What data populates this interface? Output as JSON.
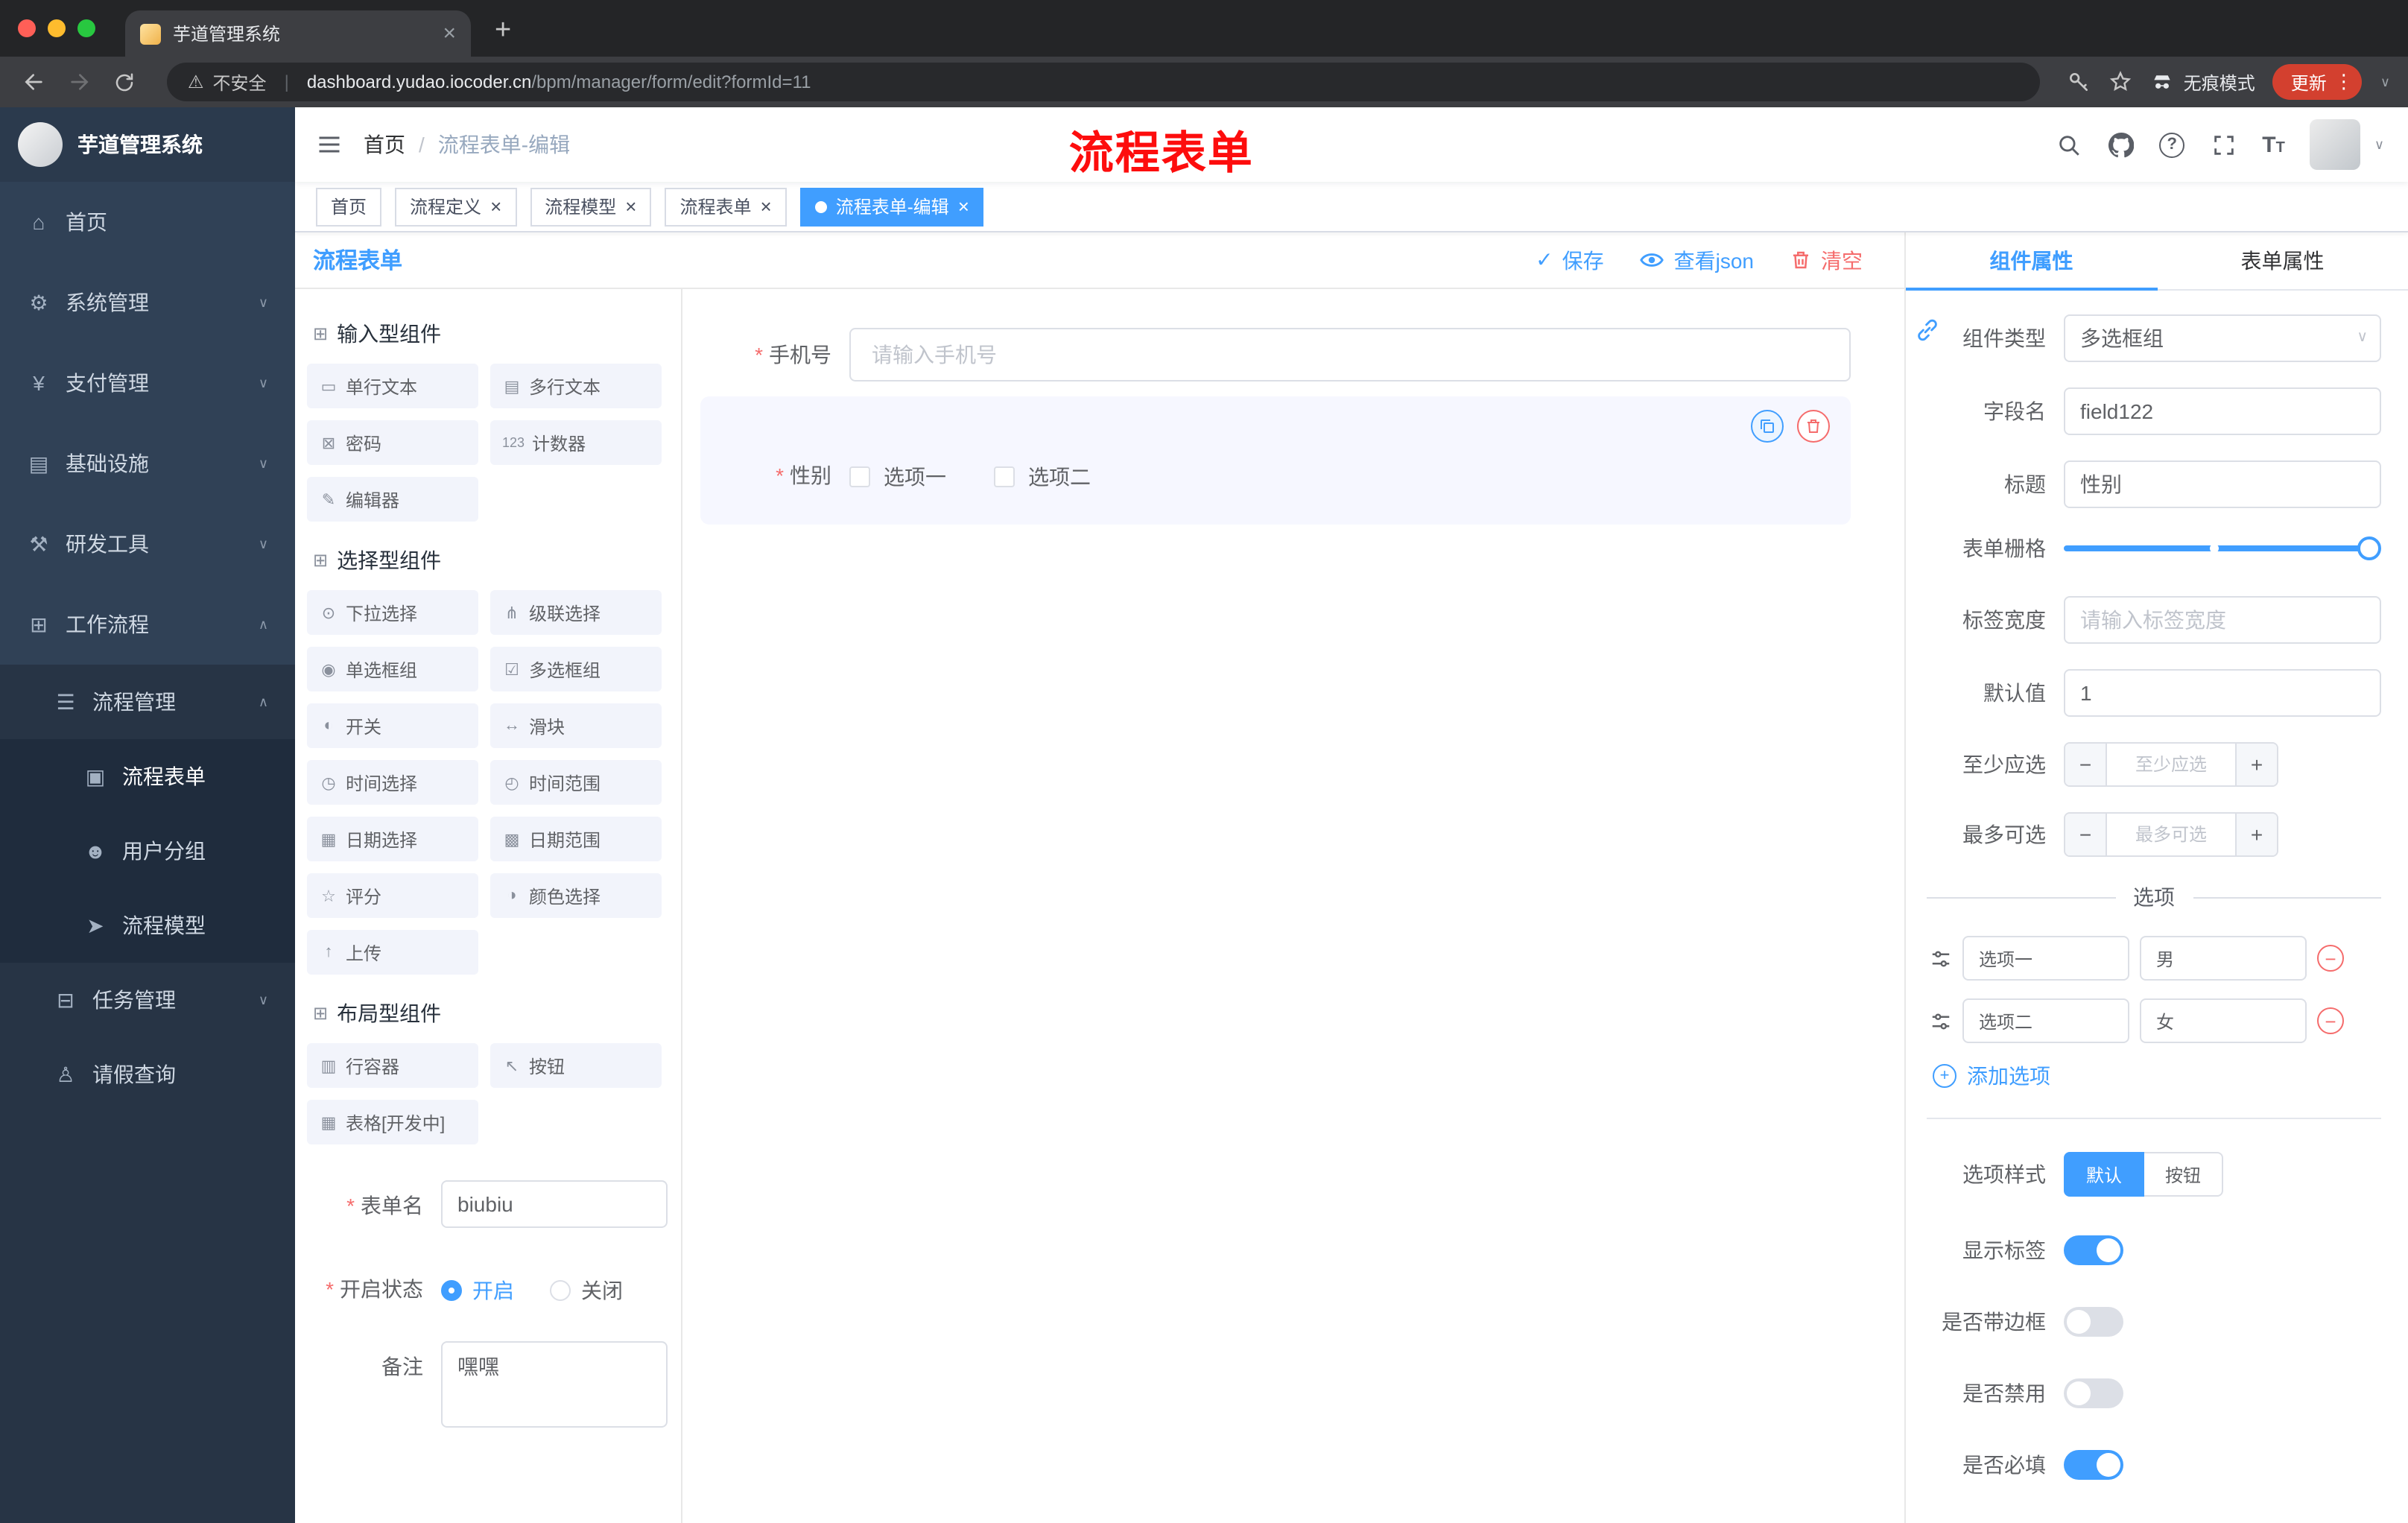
{
  "icons": {
    "home": "⌂",
    "system": "⚙",
    "payment": "¥",
    "infra": "▤",
    "devtools": "⚒",
    "workflow": "⊞",
    "process": "☰",
    "form": "▣",
    "users": "☻",
    "model": "➤",
    "task": "⊟",
    "leave": "♙",
    "group": "⊞"
  },
  "browser": {
    "tab": {
      "title": "芋道管理系统"
    },
    "address": {
      "security_label": "不安全",
      "domain": "dashboard.yudao.iocoder.cn",
      "path": "/bpm/manager/form/edit?formId=11"
    },
    "incognito_label": "无痕模式",
    "update_label": "更新"
  },
  "sidebar": {
    "logo_title": "芋道管理系统",
    "menu": [
      {
        "label": "首页"
      },
      {
        "label": "系统管理"
      },
      {
        "label": "支付管理"
      },
      {
        "label": "基础设施"
      },
      {
        "label": "研发工具"
      },
      {
        "label": "工作流程"
      },
      {
        "label": "流程管理"
      },
      {
        "label": "流程表单"
      },
      {
        "label": "用户分组"
      },
      {
        "label": "流程模型"
      },
      {
        "label": "任务管理"
      },
      {
        "label": "请假查询"
      }
    ]
  },
  "header": {
    "breadcrumb": {
      "home": "首页",
      "separator": "/",
      "current": "流程表单-编辑"
    },
    "annotation": "流程表单"
  },
  "tags": [
    {
      "label": "首页"
    },
    {
      "label": "流程定义"
    },
    {
      "label": "流程模型"
    },
    {
      "label": "流程表单"
    },
    {
      "label": "流程表单-编辑"
    }
  ],
  "designer": {
    "title": "流程表单",
    "actions": {
      "save": "保存",
      "view_json": "查看json",
      "clear": "清空"
    },
    "groups": [
      {
        "title": "输入型组件",
        "items": [
          {
            "icon": "▭",
            "label": "单行文本"
          },
          {
            "icon": "▤",
            "label": "多行文本"
          },
          {
            "icon": "⊠",
            "label": "密码"
          },
          {
            "icon": "123",
            "label": "计数器"
          },
          {
            "icon": "✎",
            "label": "编辑器"
          }
        ]
      },
      {
        "title": "选择型组件",
        "items": [
          {
            "icon": "⊙",
            "label": "下拉选择"
          },
          {
            "icon": "⋔",
            "label": "级联选择"
          },
          {
            "icon": "◉",
            "label": "单选框组"
          },
          {
            "icon": "☑",
            "label": "多选框组"
          },
          {
            "icon": "◐",
            "label": "开关"
          },
          {
            "icon": "↔",
            "label": "滑块"
          },
          {
            "icon": "◷",
            "label": "时间选择"
          },
          {
            "icon": "◴",
            "label": "时间范围"
          },
          {
            "icon": "▦",
            "label": "日期选择"
          },
          {
            "icon": "▩",
            "label": "日期范围"
          },
          {
            "icon": "☆",
            "label": "评分"
          },
          {
            "icon": "◑",
            "label": "颜色选择"
          },
          {
            "icon": "↑",
            "label": "上传"
          }
        ]
      },
      {
        "title": "布局型组件",
        "items": [
          {
            "icon": "▥",
            "label": "行容器"
          },
          {
            "icon": "↖",
            "label": "按钮"
          },
          {
            "icon": "▦",
            "label": "表格[开发中]"
          }
        ]
      }
    ],
    "meta": {
      "form_name": {
        "label": "表单名",
        "value": "biubiu"
      },
      "status": {
        "label": "开启状态",
        "on": "开启",
        "off": "关闭"
      },
      "remark": {
        "label": "备注",
        "value": "嘿嘿"
      }
    },
    "canvas": {
      "phone": {
        "label": "手机号",
        "placeholder": "请输入手机号"
      },
      "gender": {
        "label": "性别",
        "options": [
          "选项一",
          "选项二"
        ]
      }
    }
  },
  "panel": {
    "tabs": {
      "component": "组件属性",
      "form": "表单属性"
    },
    "component_type": {
      "label": "组件类型",
      "value": "多选框组"
    },
    "field_name": {
      "label": "字段名",
      "value": "field122"
    },
    "title": {
      "label": "标题",
      "value": "性别"
    },
    "grid": {
      "label": "表单栅格"
    },
    "label_width": {
      "label": "标签宽度",
      "placeholder": "请输入标签宽度"
    },
    "default_value": {
      "label": "默认值",
      "value": "1"
    },
    "min_select": {
      "label": "至少应选",
      "placeholder": "至少应选"
    },
    "max_select": {
      "label": "最多可选",
      "placeholder": "最多可选"
    },
    "options_title": "选项",
    "options": [
      {
        "label": "选项一",
        "value": "男"
      },
      {
        "label": "选项二",
        "value": "女"
      }
    ],
    "add_option": "添加选项",
    "option_style": {
      "label": "选项样式",
      "default": "默认",
      "button": "按钮"
    },
    "switches": [
      {
        "label": "显示标签",
        "on": true
      },
      {
        "label": "是否带边框",
        "on": false
      },
      {
        "label": "是否禁用",
        "on": false
      },
      {
        "label": "是否必填",
        "on": true
      }
    ]
  }
}
